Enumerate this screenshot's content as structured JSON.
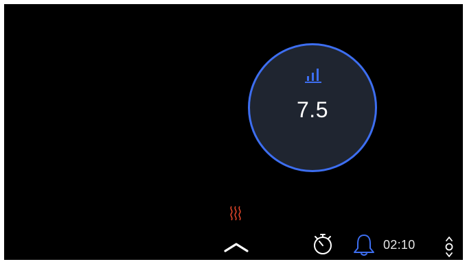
{
  "cooktop": {
    "active_zone": {
      "power_level": "7.5",
      "icon": "power-level-bars-icon"
    },
    "indicators": {
      "residual_heat_icon": "heat-waves-icon"
    },
    "controls": {
      "expand_icon": "chevron-up-icon",
      "timer_icon": "stopwatch-icon",
      "alarm_icon": "bell-icon",
      "timer_value": "02:10",
      "adjust_icon": "up-down-stepper-icon"
    }
  },
  "colors": {
    "background": "#000000",
    "accent": "#3d6ef0",
    "dial_fill": "#1f2530",
    "heat": "#e0462a",
    "text": "#ffffff"
  }
}
